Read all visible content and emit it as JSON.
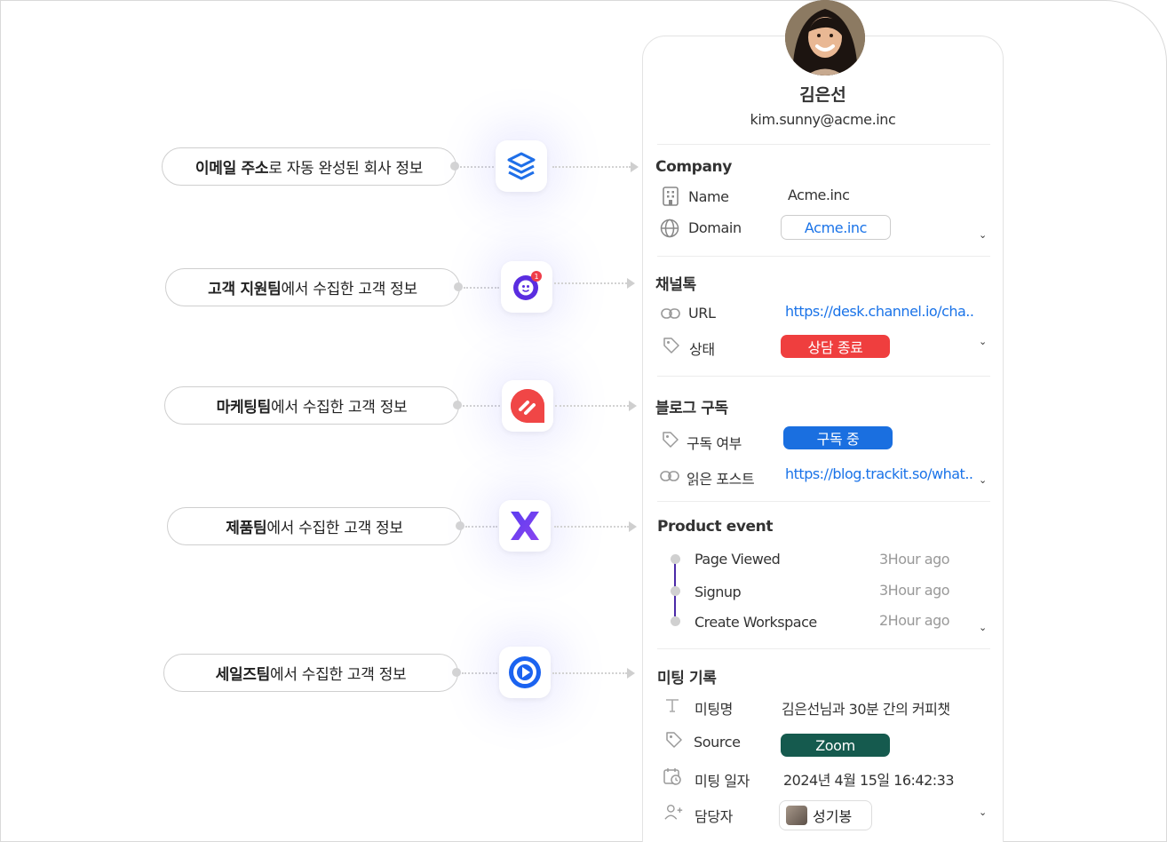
{
  "sources": [
    {
      "bold": "이메일 주소",
      "rest": "로 자동 완성된 회사 정보",
      "icon": "stack-layers-icon"
    },
    {
      "bold": "고객 지원팀",
      "rest": "에서 수집한 고객 정보",
      "icon": "channeltalk-icon",
      "badge": "1"
    },
    {
      "bold": "마케팅팀",
      "rest": "에서 수집한 고객 정보",
      "icon": "marketing-app-icon"
    },
    {
      "bold": "제품팀",
      "rest": "에서 수집한 고객 정보",
      "icon": "product-x-icon"
    },
    {
      "bold": "세일즈팀",
      "rest": "에서 수집한 고객 정보",
      "icon": "sales-play-icon"
    }
  ],
  "profile": {
    "name": "김은선",
    "email": "kim.sunny@acme.inc"
  },
  "company": {
    "title": "Company",
    "name_label": "Name",
    "name_value": "Acme.inc",
    "domain_label": "Domain",
    "domain_value": "Acme.inc"
  },
  "channeltalk": {
    "title": "채널톡",
    "url_label": "URL",
    "url_value": "https://desk.channel.io/cha..",
    "status_label": "상태",
    "status_value": "상담 종료",
    "status_color": "#ef3e3e"
  },
  "blog": {
    "title": "블로그 구독",
    "sub_label": "구독 여부",
    "sub_value": "구독 중",
    "sub_color": "#1a6fe0",
    "post_label": "읽은 포스트",
    "post_value": "https://blog.trackit.so/what.."
  },
  "product": {
    "title": "Product event",
    "events": [
      {
        "name": "Page Viewed",
        "time": "3Hour ago"
      },
      {
        "name": "Signup",
        "time": "3Hour ago"
      },
      {
        "name": "Create Workspace",
        "time": "2Hour ago"
      }
    ]
  },
  "meeting": {
    "title": "미팅 기록",
    "name_label": "미팅명",
    "name_value": "김은선님과 30분 간의 커피챗",
    "source_label": "Source",
    "source_value": "Zoom",
    "source_color": "#155a4e",
    "date_label": "미팅 일자",
    "date_value": "2024년 4월 15일 16:42:33",
    "owner_label": "담당자",
    "owner_value": "성기봉"
  },
  "chevron": "⌄"
}
